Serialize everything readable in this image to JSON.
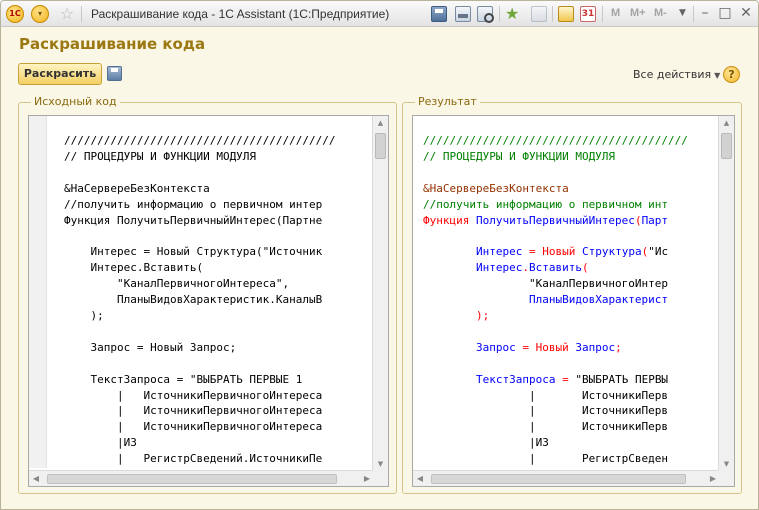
{
  "window": {
    "title": "Раскрашивание кода - 1C Assistant  (1С:Предприятие)",
    "app_logo": "1C",
    "calendar_day": "31",
    "memory_buttons": [
      "M",
      "M+",
      "M-"
    ]
  },
  "header": {
    "title": "Раскрашивание кода",
    "colorize_button": "Раскрасить",
    "all_actions": "Все действия",
    "help": "?"
  },
  "source_panel": {
    "label": "Исходный код",
    "lines": [
      "/////////////////////////////////////////",
      "// ПРОЦЕДУРЫ И ФУНКЦИИ МОДУЛЯ",
      "",
      "&НаСервереБезКонтекста",
      "//получить информацию о первичном интер",
      "Функция ПолучитьПервичныйИнтерес(Партне",
      "",
      "    Интерес = Новый Структура(\"Источник",
      "    Интерес.Вставить(",
      "        \"КаналПервичногоИнтереса\",",
      "        ПланыВидовХарактеристик.КаналыВ",
      "    );",
      "",
      "    Запрос = Новый Запрос;",
      "",
      "    ТекстЗапроса = \"ВЫБРАТЬ ПЕРВЫЕ 1",
      "        |   ИсточникиПервичногоИнтереса",
      "        |   ИсточникиПервичногоИнтереса",
      "        |   ИсточникиПервичногоИнтереса",
      "        |ИЗ",
      "        |   РегистрСведений.ИсточникиПе"
    ]
  },
  "result_panel": {
    "label": "Результат",
    "lines": [
      [
        {
          "t": "////////////////////////////////////////",
          "c": "comment"
        }
      ],
      [
        {
          "t": "// ПРОЦЕДУРЫ И ФУНКЦИИ МОДУЛЯ",
          "c": "comment"
        }
      ],
      [],
      [
        {
          "t": "&НаСервереБезКонтекста",
          "c": "pre"
        }
      ],
      [
        {
          "t": "//получить информацию о первичном инт",
          "c": "comment"
        }
      ],
      [
        {
          "t": "Функция",
          "c": "kw"
        },
        {
          "t": " ",
          "c": "str"
        },
        {
          "t": "ПолучитьПервичныйИнтерес",
          "c": "id"
        },
        {
          "t": "(",
          "c": "op"
        },
        {
          "t": "Парт",
          "c": "id"
        }
      ],
      [],
      [
        {
          "t": "        ",
          "c": "str"
        },
        {
          "t": "Интерес",
          "c": "id"
        },
        {
          "t": " = ",
          "c": "op"
        },
        {
          "t": "Новый",
          "c": "kw"
        },
        {
          "t": " ",
          "c": "str"
        },
        {
          "t": "Структура",
          "c": "id"
        },
        {
          "t": "(",
          "c": "op"
        },
        {
          "t": "\"Ис",
          "c": "str"
        }
      ],
      [
        {
          "t": "        ",
          "c": "str"
        },
        {
          "t": "Интерес",
          "c": "id"
        },
        {
          "t": ".",
          "c": "op"
        },
        {
          "t": "Вставить",
          "c": "id"
        },
        {
          "t": "(",
          "c": "op"
        }
      ],
      [
        {
          "t": "                \"КаналПервичногоИнтер",
          "c": "str"
        }
      ],
      [
        {
          "t": "                ",
          "c": "str"
        },
        {
          "t": "ПланыВидовХарактерист",
          "c": "id"
        }
      ],
      [
        {
          "t": "        ",
          "c": "str"
        },
        {
          "t": ");",
          "c": "op"
        }
      ],
      [],
      [
        {
          "t": "        ",
          "c": "str"
        },
        {
          "t": "Запрос",
          "c": "id"
        },
        {
          "t": " = ",
          "c": "op"
        },
        {
          "t": "Новый",
          "c": "kw"
        },
        {
          "t": " ",
          "c": "str"
        },
        {
          "t": "Запрос",
          "c": "id"
        },
        {
          "t": ";",
          "c": "op"
        }
      ],
      [],
      [
        {
          "t": "        ",
          "c": "str"
        },
        {
          "t": "ТекстЗапроса",
          "c": "id"
        },
        {
          "t": " = ",
          "c": "op"
        },
        {
          "t": "\"ВЫБРАТЬ ПЕРВЫ",
          "c": "str"
        }
      ],
      [
        {
          "t": "                |       ИсточникиПерв",
          "c": "str"
        }
      ],
      [
        {
          "t": "                |       ИсточникиПерв",
          "c": "str"
        }
      ],
      [
        {
          "t": "                |       ИсточникиПерв",
          "c": "str"
        }
      ],
      [
        {
          "t": "                |ИЗ",
          "c": "str"
        }
      ],
      [
        {
          "t": "                |       РегистрСведен",
          "c": "str"
        }
      ]
    ]
  },
  "icons": {
    "window_logo": "1c-logo-icon",
    "menu": "menu-dropdown-icon",
    "favorite": "star-icon",
    "save": "save-icon",
    "print": "print-icon",
    "preview": "print-preview-icon",
    "add_favorite": "add-favorite-icon",
    "calculator": "calculator-icon",
    "calendar": "calendar-icon",
    "help": "help-icon"
  },
  "colors": {
    "comment": "#008000",
    "preprocessor": "#963200",
    "keyword": "#ff0000",
    "identifier": "#0000ff",
    "title": "#9b7812"
  }
}
